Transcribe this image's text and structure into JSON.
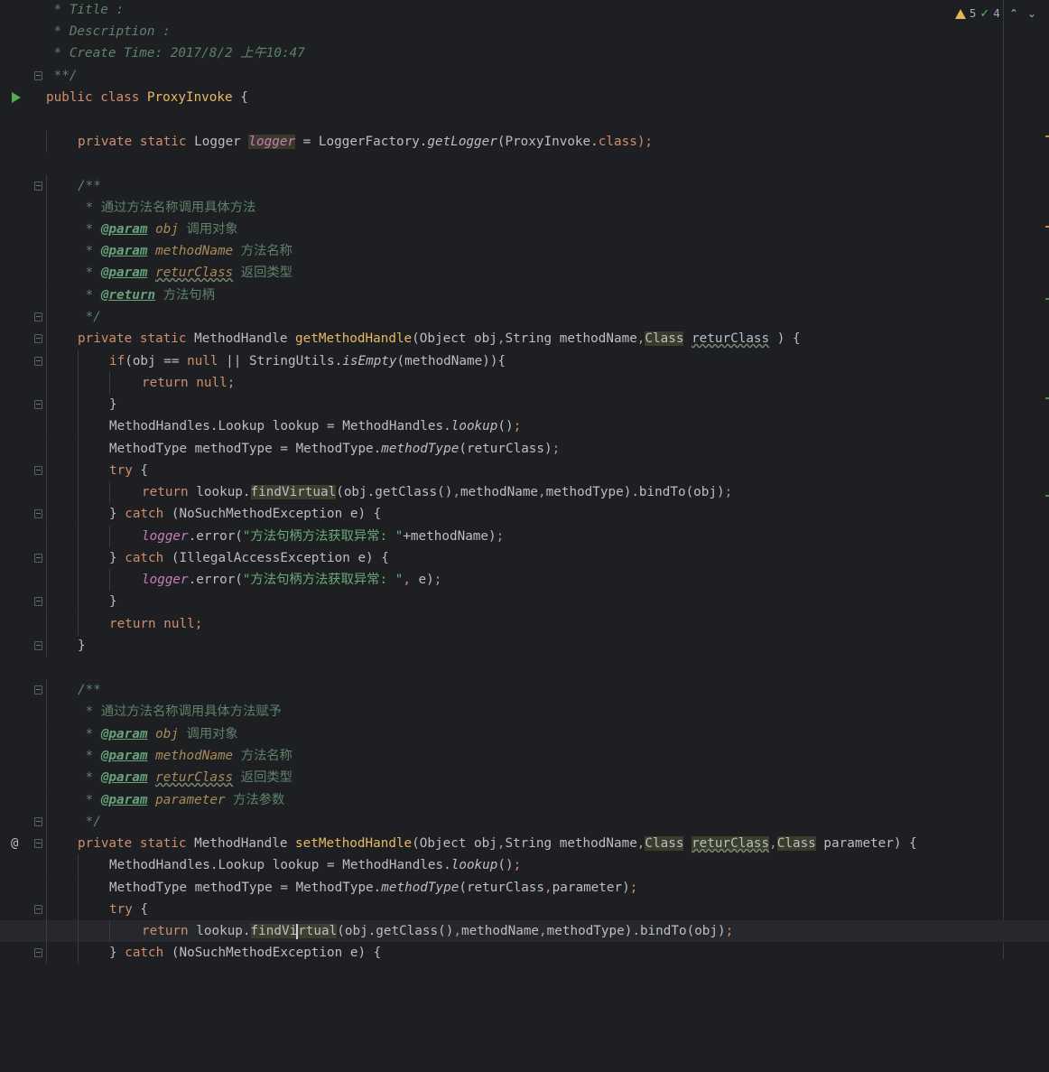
{
  "inspections": {
    "warnings": "5",
    "weak_warnings": "4"
  },
  "icons": {
    "run": "run-gutter-icon",
    "implements": "@",
    "warning": "warning-icon",
    "check": "check-icon",
    "up": "^",
    "down": "v"
  },
  "code": {
    "l01": {
      "a": " * Title :"
    },
    "l02": {
      "a": " * Description :"
    },
    "l03": {
      "a": " * Create Time: 2017/8/2 上午10:47"
    },
    "l04": {
      "a": " **/"
    },
    "l05": {
      "kw1": "public",
      "kw2": "class",
      "name": "ProxyInvoke",
      "rest": " {"
    },
    "l06": {},
    "l07": {
      "kw1": "private",
      "kw2": "static",
      "type": "Logger ",
      "field": "logger",
      "eq": " = LoggerFactory.",
      "call": "getLogger",
      "args": "(ProxyInvoke.",
      "kwc": "class",
      "end": ");"
    },
    "l08": {},
    "l09": {
      "a": "/**"
    },
    "l10": {
      "a": " * 通过方法名称调用具体方法"
    },
    "l11": {
      "star": " * ",
      "tag": "@param",
      "pname": "obj",
      "desc": " 调用对象"
    },
    "l12": {
      "star": " * ",
      "tag": "@param",
      "pname": "methodName",
      "desc": " 方法名称"
    },
    "l13": {
      "star": " * ",
      "tag": "@param",
      "pname": "returClass",
      "desc": " 返回类型"
    },
    "l14": {
      "star": " * ",
      "tag": "@return",
      "desc": " 方法句柄"
    },
    "l15": {
      "a": " */"
    },
    "l16": {
      "kw1": "private",
      "kw2": "static",
      "type": "MethodHandle ",
      "name": "getMethodHandle",
      "p1": "(Object obj",
      "c1": ",",
      "p2": "String methodName",
      "c2": ",",
      "cls": "Class",
      "sp": " ",
      "pv": "returClass",
      "end": " ) {"
    },
    "l17": {
      "kw": "if",
      "a": "(obj == ",
      "kwn": "null",
      "b": " || StringUtils.",
      "call": "isEmpty",
      "c": "(methodName)){"
    },
    "l18": {
      "kw": "return",
      "kwn": "null",
      "semi": ";"
    },
    "l19": {
      "a": "}"
    },
    "l20": {
      "a": "MethodHandles.Lookup lookup = MethodHandles.",
      "call": "lookup",
      "b": "()",
      "semi": ";"
    },
    "l21": {
      "a": "MethodType methodType = MethodType.",
      "call": "methodType",
      "b": "(returClass)",
      "semi": ";"
    },
    "l22": {
      "kw": "try",
      "a": " {"
    },
    "l23": {
      "kw": "return",
      "a": "lookup.",
      "hl": "findVirtual",
      "b": "(obj.getClass()",
      "c1": ",",
      "c": "methodName",
      "c2": ",",
      "d": "methodType).bindTo(obj)",
      "semi": ";"
    },
    "l24": {
      "a": "} ",
      "kw": "catch",
      "b": " (NoSuchMethodException e) {"
    },
    "l25": {
      "field": "logger",
      "a": ".error(",
      "str": "\"方法句柄方法获取异常: \"",
      "b": "+methodName)",
      "semi": ";"
    },
    "l26": {
      "a": "} ",
      "kw": "catch",
      "b": " (IllegalAccessException e) {"
    },
    "l27": {
      "field": "logger",
      "a": ".error(",
      "str": "\"方法句柄方法获取异常: \"",
      "c": ",",
      "b": " e)",
      "semi": ";"
    },
    "l28": {
      "a": "}"
    },
    "l29": {
      "kw": "return",
      "kwn": "null",
      "semi": ";"
    },
    "l30": {
      "a": "}"
    },
    "l31": {},
    "l32": {
      "a": "/**"
    },
    "l33": {
      "a": " * 通过方法名称调用具体方法赋予"
    },
    "l34": {
      "star": " * ",
      "tag": "@param",
      "pname": "obj",
      "desc": " 调用对象"
    },
    "l35": {
      "star": " * ",
      "tag": "@param",
      "pname": "methodName",
      "desc": " 方法名称"
    },
    "l36": {
      "star": " * ",
      "tag": "@param",
      "pname": "returClass",
      "desc": " 返回类型"
    },
    "l37": {
      "star": " * ",
      "tag": "@param",
      "pname": "parameter",
      "desc": " 方法参数"
    },
    "l38": {
      "a": " */"
    },
    "l39": {
      "kw1": "private",
      "kw2": "static",
      "type": "MethodHandle ",
      "name": "setMethodHandle",
      "p1": "(Object obj",
      "c1": ",",
      "p2": "String methodName",
      "c2": ",",
      "cls": "Class",
      "sp": " ",
      "pv": "returClass",
      "c3": ",",
      "cls2": "Class",
      "end": " parameter) {"
    },
    "l40": {
      "a": "MethodHandles.Lookup lookup = MethodHandles.",
      "call": "lookup",
      "b": "()",
      "semi": ";"
    },
    "l41": {
      "a": "MethodType methodType = MethodType.",
      "call": "methodType",
      "b": "(returClass",
      "c": ",",
      "d": "parameter)",
      "semi": ";"
    },
    "l42": {
      "kw": "try",
      "a": " {"
    },
    "l43": {
      "kw": "return",
      "a": "lookup.",
      "hl1": "findVi",
      "hl2": "rtual",
      "b": "(obj.getClass()",
      "c1": ",",
      "c": "methodName",
      "c2": ",",
      "d": "methodType).bindTo(obj)",
      "semi": ";"
    },
    "l44": {
      "a": "} ",
      "kw": "catch",
      "b": " (NoSuchMethodException e) {"
    }
  }
}
